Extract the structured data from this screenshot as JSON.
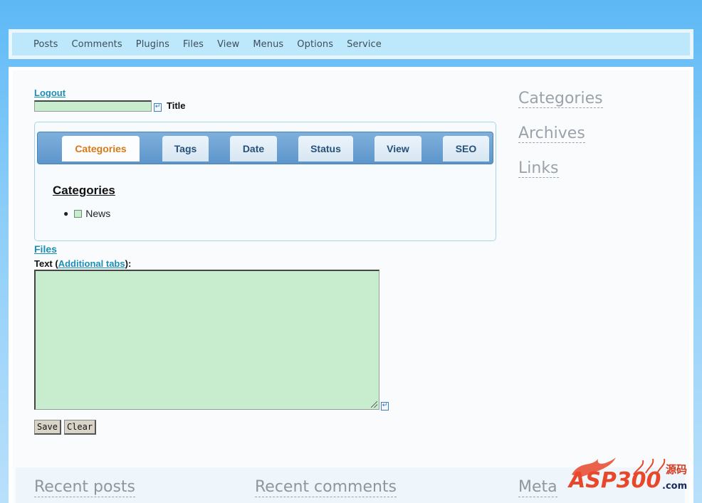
{
  "menu": {
    "items": [
      "Posts",
      "Comments",
      "Plugins",
      "Files",
      "View",
      "Menus",
      "Options",
      "Service"
    ]
  },
  "form": {
    "logout_label": "Logout",
    "title_label": "Title",
    "title_value": "",
    "tabs": [
      "Categories",
      "Tags",
      "Date",
      "Status",
      "View",
      "SEO"
    ],
    "active_tab": "Categories",
    "categories_heading": "Categories",
    "categories": [
      {
        "label": "News",
        "checked": false
      }
    ],
    "files_label": "Files",
    "text_label_prefix": "Text (",
    "text_label_link": "Additional tabs",
    "text_label_suffix": "):",
    "text_value": "",
    "save_label": "Save",
    "clear_label": "Clear"
  },
  "sidebar": {
    "links": [
      "Categories",
      "Archives",
      "Links"
    ]
  },
  "footer": {
    "titles": [
      "Recent posts",
      "Recent comments",
      "Meta"
    ]
  },
  "watermark": {
    "text": "ASP300",
    "suffix": ".com",
    "cjk": "源码"
  },
  "colors": {
    "accent": "#1b8fb5",
    "active_tab": "#d87a14",
    "field_bg": "#c8ecce"
  }
}
